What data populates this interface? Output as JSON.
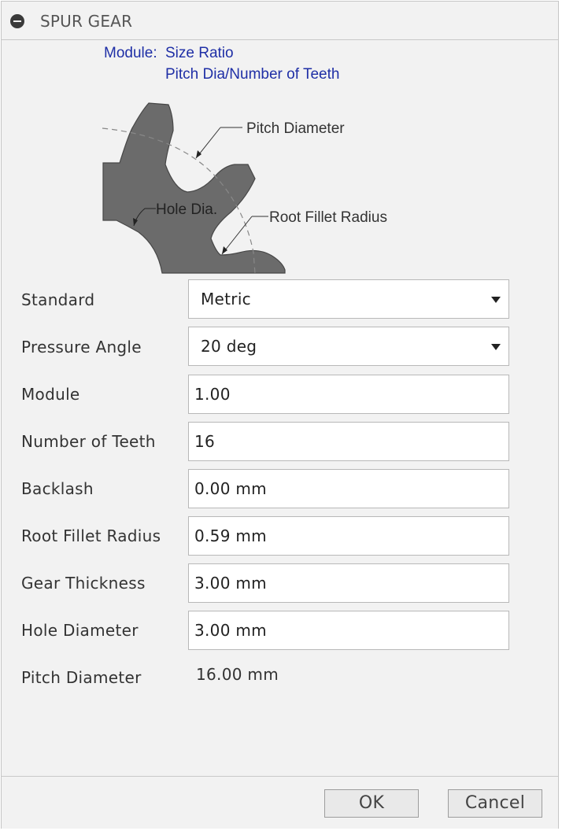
{
  "dialog": {
    "title": "SPUR GEAR",
    "collapse_icon": "minus-circle-icon"
  },
  "diagram": {
    "module_label": "Module:",
    "module_value": "Size Ratio",
    "module_formula": "Pitch Dia/Number of Teeth",
    "callout_pitch_diameter": "Pitch Diameter",
    "callout_hole_dia": "Hole Dia.",
    "callout_root_fillet": "Root Fillet Radius",
    "colors": {
      "gear_fill": "#6b6b6b",
      "header_text": "#1f2fa6"
    }
  },
  "form": {
    "standard": {
      "label": "Standard",
      "value": "Metric"
    },
    "pressure_angle": {
      "label": "Pressure Angle",
      "value": "20 deg"
    },
    "module": {
      "label": "Module",
      "value": "1.00"
    },
    "number_of_teeth": {
      "label": "Number of Teeth",
      "value": "16"
    },
    "backlash": {
      "label": "Backlash",
      "value": "0.00 mm"
    },
    "root_fillet_radius": {
      "label": "Root Fillet Radius",
      "value": "0.59 mm"
    },
    "gear_thickness": {
      "label": "Gear Thickness",
      "value": "3.00 mm"
    },
    "hole_diameter": {
      "label": "Hole Diameter",
      "value": "3.00 mm"
    },
    "pitch_diameter": {
      "label": "Pitch Diameter",
      "value": "16.00 mm"
    }
  },
  "footer": {
    "ok_label": "OK",
    "cancel_label": "Cancel"
  }
}
